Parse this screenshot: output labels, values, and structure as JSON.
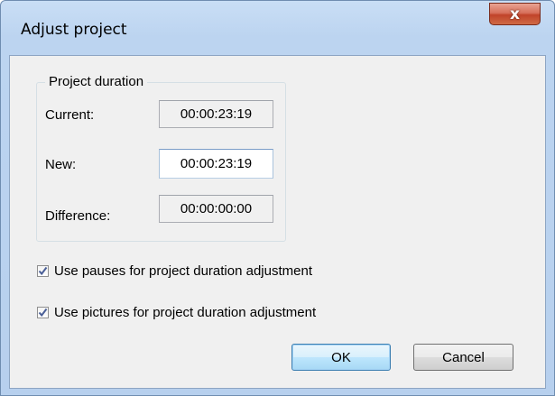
{
  "window": {
    "title": "Adjust project",
    "close_glyph": "x"
  },
  "duration_group": {
    "legend": "Project duration",
    "current_label": "Current:",
    "current_value": "00:00:23:19",
    "new_label": "New:",
    "new_value": "00:00:23:19",
    "difference_label": "Difference:",
    "difference_value": "00:00:00:00"
  },
  "options": {
    "use_pauses_label": "Use pauses for project duration adjustment",
    "use_pauses_checked": true,
    "use_pictures_label": "Use pictures  for project duration adjustment",
    "use_pictures_checked": true
  },
  "buttons": {
    "ok_label": "OK",
    "cancel_label": "Cancel"
  },
  "icons": {
    "close": "close-icon",
    "check": "checkmark-icon"
  },
  "colors": {
    "titlebar": "#bcd4f0",
    "close_button": "#c0432a",
    "client_background": "#f0f0f0",
    "default_button_border": "#3c7fb1"
  }
}
